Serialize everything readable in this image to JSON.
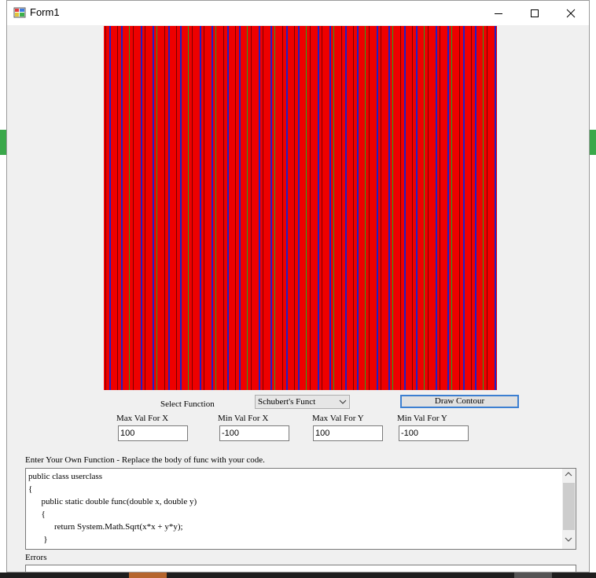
{
  "window": {
    "title": "Form1",
    "minimize_icon": "minimize-icon",
    "maximize_icon": "maximize-icon",
    "close_icon": "close-icon"
  },
  "contour": {
    "colors": {
      "background": "#ee0000",
      "stripe_blue": "#2020c8",
      "stripe_green": "#1faa1f",
      "stripe_dark": "#7a0000"
    }
  },
  "controls": {
    "select_label": "Select Function",
    "function_selected": "Schubert's Funct",
    "draw_button": "Draw Contour",
    "max_x_label": "Max Val For X",
    "max_x_value": "100",
    "min_x_label": "Min Val For X",
    "min_x_value": "-100",
    "max_y_label": "Max Val For Y",
    "max_y_value": "100",
    "min_y_label": "Min Val For Y",
    "min_y_value": "-100"
  },
  "editor": {
    "label": "Enter Your Own Function - Replace the body of func with your code.",
    "code": "public class userclass\n{\n      public static double func(double x, double y)\n      {\n            return System.Math.Sqrt(x*x + y*y);\n       }\n}"
  },
  "errors": {
    "label": "Errors"
  }
}
